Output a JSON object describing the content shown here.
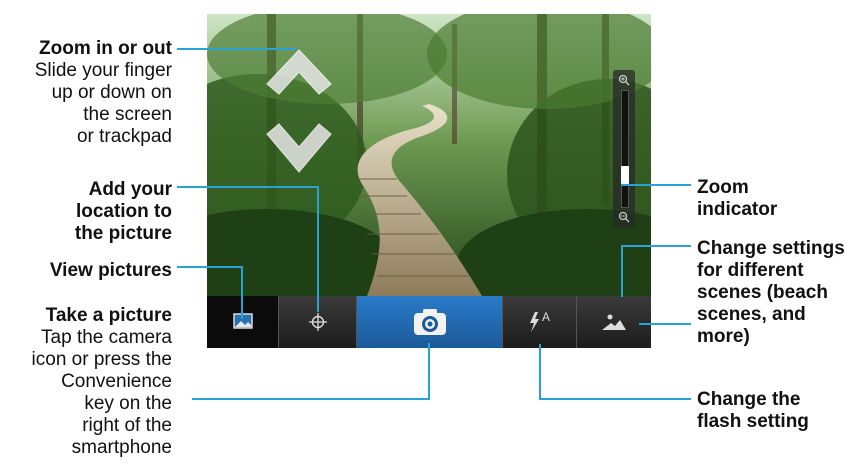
{
  "callouts": {
    "zoom_in_out": {
      "title": "Zoom in or out",
      "desc": [
        "Slide your finger",
        "up or down on",
        "the screen",
        "or trackpad"
      ]
    },
    "add_location": {
      "title": [
        "Add your",
        "location to",
        "the picture"
      ]
    },
    "view_pictures": {
      "title": "View pictures"
    },
    "take_picture": {
      "title": "Take a picture",
      "desc": [
        "Tap the camera",
        "icon or press the",
        "Convenience",
        "key on the",
        "right of the",
        "smartphone"
      ]
    },
    "zoom_indicator": {
      "title": [
        "Zoom",
        "indicator"
      ]
    },
    "scene_settings": {
      "title": [
        "Change settings",
        "for different",
        "scenes (beach",
        "scenes, and",
        "more)"
      ]
    },
    "flash_setting": {
      "title": [
        "Change the",
        "flash setting"
      ]
    }
  },
  "toolbar": {
    "items": [
      {
        "name": "view-pictures",
        "icon": "picture-icon"
      },
      {
        "name": "geotag",
        "icon": "crosshair-icon"
      },
      {
        "name": "take-picture",
        "icon": "camera-icon"
      },
      {
        "name": "flash",
        "icon": "flash-auto-icon",
        "label": "A"
      },
      {
        "name": "scene-mode",
        "icon": "landscape-icon"
      }
    ]
  },
  "colors": {
    "leader_line": "#29a3d6",
    "camera_button": "#1e6bb8",
    "toolbar": "#2a2a2a"
  },
  "zoom": {
    "level": 0.15
  }
}
